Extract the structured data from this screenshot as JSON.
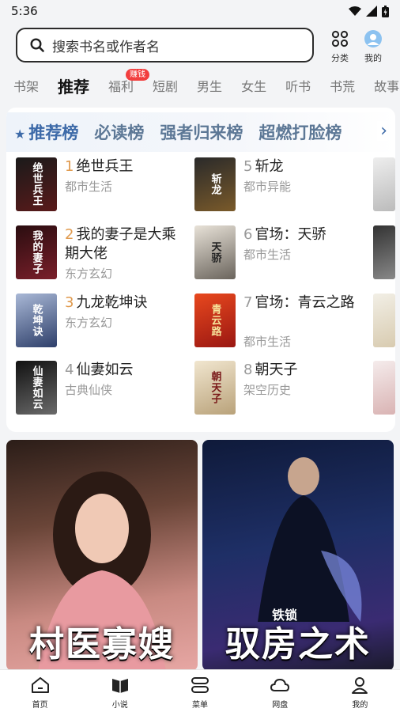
{
  "status": {
    "time": "5:36"
  },
  "search": {
    "placeholder": "搜索书名或作者名"
  },
  "top_actions": {
    "category": "分类",
    "mine": "我的"
  },
  "tabs": [
    {
      "label": "书架"
    },
    {
      "label": "推荐"
    },
    {
      "label": "福利",
      "badge": "赚钱"
    },
    {
      "label": "短剧"
    },
    {
      "label": "男生"
    },
    {
      "label": "女生"
    },
    {
      "label": "听书"
    },
    {
      "label": "书荒"
    },
    {
      "label": "故事"
    }
  ],
  "rank_tabs": [
    "推荐榜",
    "必读榜",
    "强者归来榜",
    "超燃打脸榜"
  ],
  "rank_books": [
    {
      "num": "1",
      "title": "绝世兵王",
      "genre": "都市生活",
      "cover_text": "绝世兵王",
      "cover_color": "#5a1a1a"
    },
    {
      "num": "2",
      "title": "我的妻子是大乘期大佬",
      "genre": "东方玄幻",
      "cover_text": "我的妻子",
      "cover_color": "#7a1f2a"
    },
    {
      "num": "3",
      "title": "九龙乾坤诀",
      "genre": "东方玄幻",
      "cover_text": "乾坤诀",
      "cover_color": "#2e3f6a"
    },
    {
      "num": "4",
      "title": "仙妻如云",
      "genre": "古典仙侠",
      "cover_text": "仙妻如云",
      "cover_color": "#3a3a3a"
    },
    {
      "num": "5",
      "title": "斩龙",
      "genre": "都市异能",
      "cover_text": "斩龙",
      "cover_color": "#4a3a1e"
    },
    {
      "num": "6",
      "title": "官场：天骄",
      "genre": "都市生活",
      "cover_text": "天骄",
      "cover_color": "#8a8278"
    },
    {
      "num": "7",
      "title": "官场：青云之路",
      "genre": "都市生活",
      "cover_text": "青云路",
      "cover_color": "#c8281e"
    },
    {
      "num": "8",
      "title": "朝天子",
      "genre": "架空历史",
      "cover_text": "朝天子",
      "cover_color": "#b9a27a"
    }
  ],
  "featured": [
    {
      "title": "村医寡嫂",
      "colors": [
        "#3b2a22",
        "#b97b73"
      ]
    },
    {
      "title": "驭房之术",
      "author": "铁锁",
      "colors": [
        "#1b2a55",
        "#3d2a6a"
      ]
    }
  ],
  "bottom_nav": [
    {
      "label": "首页",
      "icon": "home-icon"
    },
    {
      "label": "小说",
      "icon": "book-icon"
    },
    {
      "label": "菜单",
      "icon": "menu-icon"
    },
    {
      "label": "网盘",
      "icon": "cloud-icon"
    },
    {
      "label": "我的",
      "icon": "user-icon"
    }
  ],
  "colors": {
    "accent": "#3d6aa8",
    "badge": "#f23e3e",
    "rank_num_top": "#e09a4e"
  }
}
